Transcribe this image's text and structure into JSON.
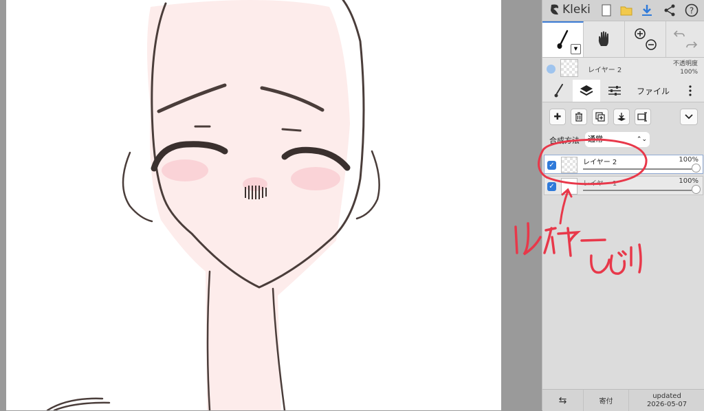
{
  "app": {
    "name": "Kleki"
  },
  "toolbar": {
    "new_icon": "new-file-icon",
    "open_icon": "folder-icon",
    "save_icon": "download-icon",
    "share_icon": "share-icon",
    "help_icon": "help-icon"
  },
  "layer_info": {
    "name": "レイヤー 2",
    "opacity_label": "不透明度",
    "opacity_value": "100%"
  },
  "tabs": {
    "file": "ファイル"
  },
  "blend": {
    "label": "合成方法",
    "value": "通常"
  },
  "layers": [
    {
      "name": "レイヤー 2",
      "opacity": "100%",
      "opacity_fraction": 1.0,
      "visible": true,
      "selected": true
    },
    {
      "name": "レイヤー 1",
      "opacity": "100%",
      "opacity_fraction": 1.0,
      "visible": true,
      "selected": false
    }
  ],
  "bottom": {
    "donate": "寄付",
    "updated_label": "updated",
    "updated_date": "2026-05-07"
  },
  "annotation": {
    "text": "レイヤーしばり"
  },
  "colors": {
    "accent": "#2f7ad9",
    "annotation_red": "#e8384a",
    "skin": "#fdeceb",
    "line": "#4a3d3a"
  }
}
